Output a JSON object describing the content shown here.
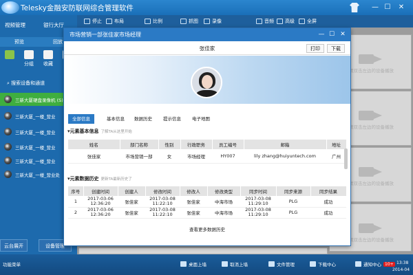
{
  "app": {
    "title": "Telesky金融安防联网综合管理软件",
    "window_controls": {
      "minimize": "—",
      "maximize": "☐",
      "close": "✕"
    }
  },
  "toolbar": {
    "items": [
      {
        "label": "停止",
        "icon": "stop-icon"
      },
      {
        "label": "布局",
        "icon": "layout-icon"
      },
      {
        "label": "比例",
        "icon": "ratio-icon"
      },
      {
        "label": "抓图",
        "icon": "snapshot-icon"
      },
      {
        "label": "录像",
        "icon": "record-icon"
      },
      {
        "label": "音频",
        "icon": "audio-icon"
      },
      {
        "label": "高级",
        "icon": "advanced-icon"
      },
      {
        "label": "全屏",
        "icon": "fullscreen-icon"
      }
    ]
  },
  "sidebar": {
    "tabs": [
      "视频管理",
      "银行大厅"
    ],
    "subtabs": [
      "预览",
      "回放"
    ],
    "icon_buttons": [
      {
        "label": "",
        "icon": "play-icon"
      },
      {
        "label": "分组",
        "icon": "group-icon"
      },
      {
        "label": "收藏",
        "icon": "favorite-icon"
      },
      {
        "label": "",
        "icon": "grid-icon"
      }
    ],
    "search_label": "搜索设备和通道",
    "devices": [
      {
        "label": "三新大厦硬盘录像机 (S)",
        "selected": true
      },
      {
        "label": "三新大厦_一楼_营业",
        "selected": false
      },
      {
        "label": "三新大厦_一楼_营业",
        "selected": false
      },
      {
        "label": "三新大厦_一楼_营业",
        "selected": false
      },
      {
        "label": "三新大厦_一楼_营业",
        "selected": false
      },
      {
        "label": "三新大厦_一楼_营业处",
        "selected": false
      }
    ],
    "bottom_buttons": [
      "云台展开",
      "设备管理"
    ]
  },
  "grid_placeholder_text": "请双击左边的设备播放",
  "statusbar": {
    "left_label": "功能菜单",
    "items": [
      "桌面上墙",
      "取消上墙",
      "文件管理",
      "下载中心",
      "通知中心"
    ],
    "notification_badge": "10+",
    "time": "13:38",
    "date": "2014-04"
  },
  "dialog": {
    "title": "市场营销一部张佳家市场经理",
    "person_name": "张佳家",
    "print_button": "打印",
    "download_button": "下载",
    "tabs": [
      "全部信息",
      "基本信息",
      "数据历史",
      "提示信息",
      "电子地图"
    ],
    "active_tab": 0,
    "basic_section": {
      "title": "元素基本信息",
      "hint": "了解TA从这里开始",
      "columns": [
        "姓名",
        "部门名称",
        "性别",
        "行政职务",
        "员工编号",
        "邮箱",
        "地址"
      ],
      "rows": [
        [
          "张佳家",
          "市场营销一部",
          "女",
          "市场经理",
          "HY007",
          "lily zhang@huiyuntech.com",
          "广州"
        ]
      ]
    },
    "history_section": {
      "title": "元素数据历史",
      "hint": "更新TA最新历史了",
      "columns": [
        "序号",
        "创建时间",
        "创建人",
        "修改时间",
        "修改人",
        "修改类型",
        "同步时间",
        "同步来源",
        "同步结果"
      ],
      "rows": [
        [
          "1",
          "2017-03-06 12:36:20",
          "张佳家",
          "2017-03-08 11:22:10",
          "张佳家",
          "中海市场",
          "2017-03-08 11:29:10",
          "PLG",
          "成功"
        ],
        [
          "2",
          "2017-03-06 12:36:20",
          "张佳家",
          "2017-03-08 11:22:10",
          "张佳家",
          "中海市场",
          "2017-03-08 11:29:10",
          "PLG",
          "成功"
        ]
      ]
    },
    "more_link": "查看更多数据历史"
  },
  "colors": {
    "primary": "#2b7ac5",
    "selected_device": "#3fae3f",
    "badge": "#e21e1e"
  }
}
